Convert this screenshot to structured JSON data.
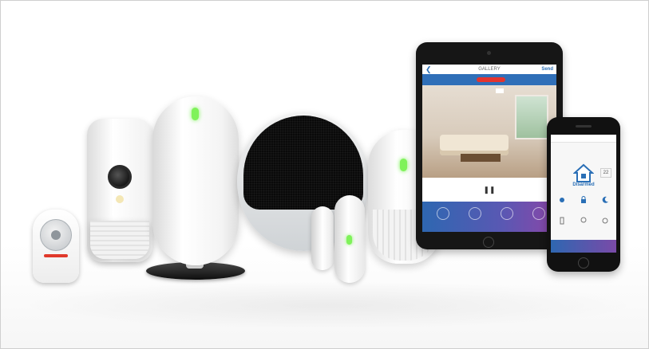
{
  "tablet": {
    "title": "GALLERY",
    "back_glyph": "❮",
    "send_label": "Send",
    "pause_glyph": "❚❚"
  },
  "phone": {
    "status_label": "Disarmed",
    "temperature": "22"
  },
  "colors": {
    "led_green": "#7ff25a",
    "app_blue": "#2f6fb8",
    "app_purple": "#8a46a8",
    "alert_red": "#e3342f"
  }
}
